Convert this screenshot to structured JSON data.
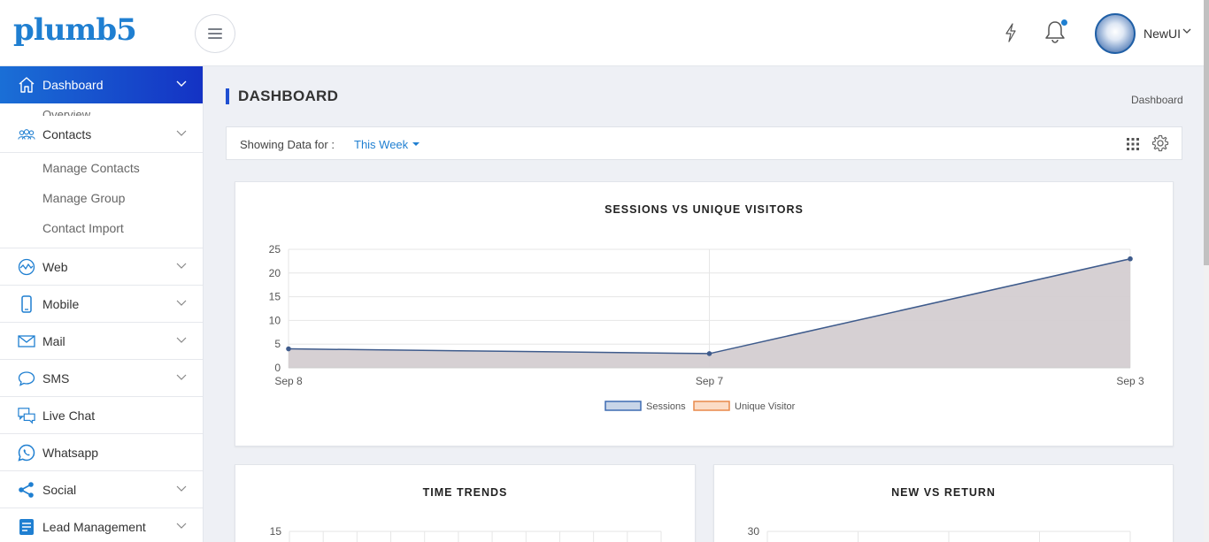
{
  "header": {
    "logo": "plumb5",
    "user_name": "NewUI"
  },
  "sidebar": {
    "items": [
      {
        "label": "Dashboard",
        "icon": "home-icon"
      },
      {
        "label": "Contacts",
        "icon": "contacts-icon"
      },
      {
        "label": "Web",
        "icon": "web-icon"
      },
      {
        "label": "Mobile",
        "icon": "mobile-icon"
      },
      {
        "label": "Mail",
        "icon": "mail-icon"
      },
      {
        "label": "SMS",
        "icon": "sms-icon"
      },
      {
        "label": "Live Chat",
        "icon": "live-chat-icon"
      },
      {
        "label": "Whatsapp",
        "icon": "whatsapp-icon"
      },
      {
        "label": "Social",
        "icon": "social-icon"
      },
      {
        "label": "Lead Management",
        "icon": "lead-management-icon"
      }
    ],
    "dashboard_sub_peek": "Overview",
    "contacts_sub": [
      "Manage Contacts",
      "Manage Group",
      "Contact Import"
    ]
  },
  "page": {
    "title": "DASHBOARD",
    "breadcrumb": "Dashboard"
  },
  "filter": {
    "label": "Showing Data for :",
    "value": "This Week"
  },
  "cards": {
    "sessions_title": "SESSIONS VS UNIQUE VISITORS",
    "time_trends_title": "TIME TRENDS",
    "new_vs_return_title": "NEW VS RETURN"
  },
  "colors": {
    "accent": "#1f7fd1",
    "sidebar_active_start": "#1a6fd6",
    "sidebar_active_end": "#1432c4",
    "sessions_line": "#3e5b8c",
    "sessions_fill": "#d4cdd1",
    "unique_visitor": "#e8894a"
  },
  "chart_data": [
    {
      "type": "area",
      "title": "SESSIONS VS UNIQUE VISITORS",
      "categories": [
        "Sep 8",
        "Sep 7",
        "Sep 3"
      ],
      "series": [
        {
          "name": "Sessions",
          "values": [
            4,
            3,
            23
          ]
        },
        {
          "name": "Unique Visitor",
          "values": []
        }
      ],
      "ylim": [
        0,
        25
      ],
      "yticks": [
        0,
        5,
        10,
        15,
        20,
        25
      ],
      "legend": "bottom",
      "grid": true
    },
    {
      "type": "line",
      "title": "TIME TRENDS",
      "yticks_visible": [
        15
      ]
    },
    {
      "type": "line",
      "title": "NEW VS RETURN",
      "yticks_visible": [
        30
      ]
    }
  ]
}
